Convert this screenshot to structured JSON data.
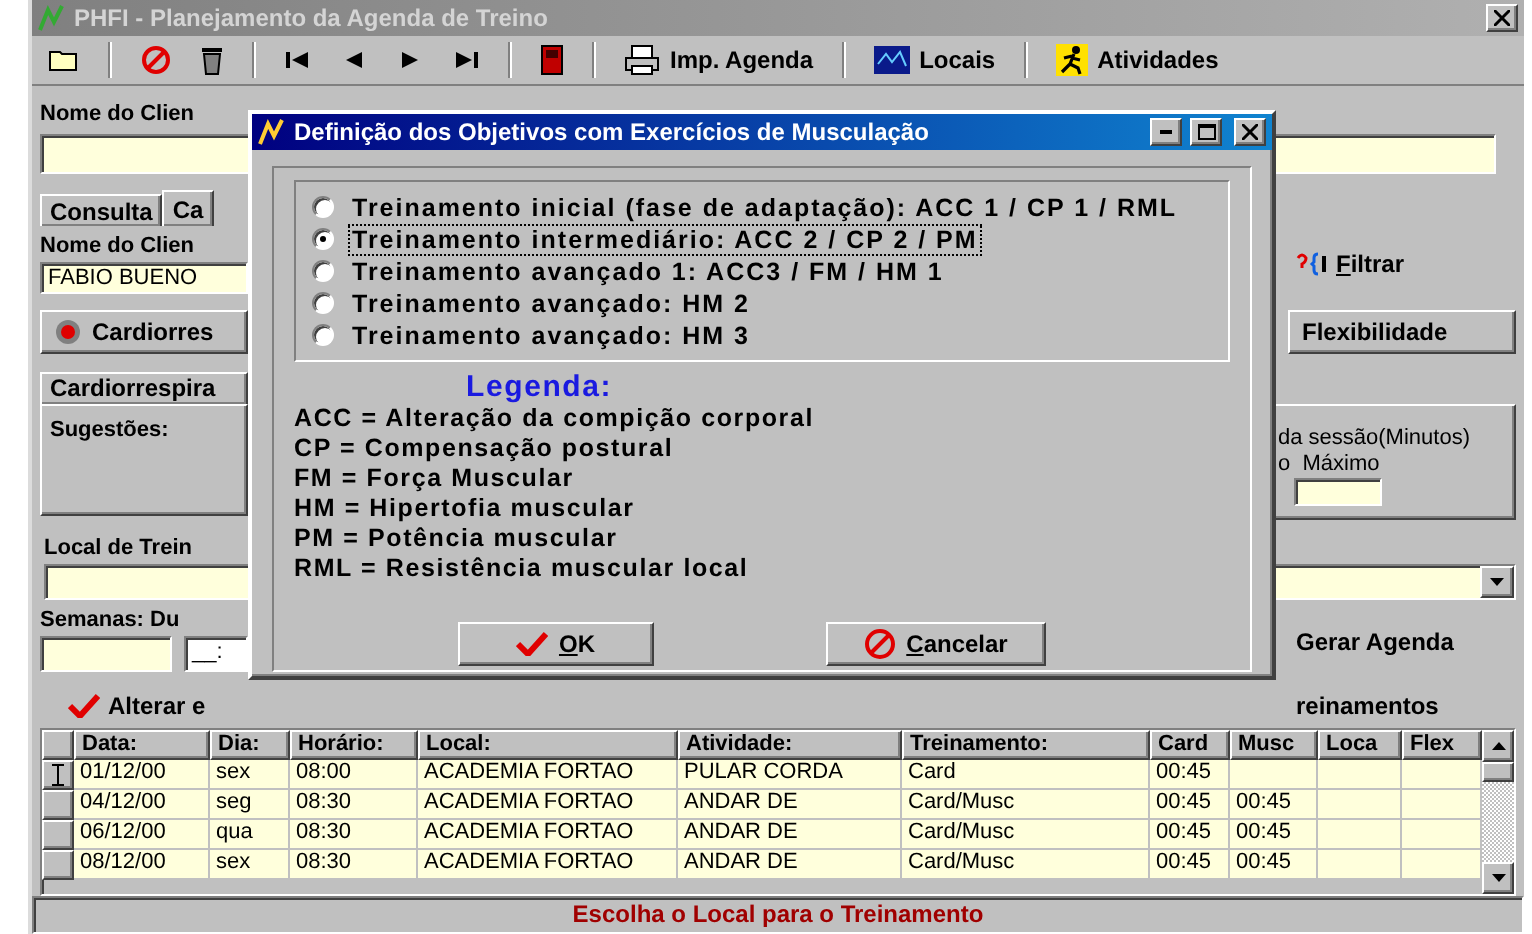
{
  "window": {
    "title": "PHFI - Planejamento da Agenda de Treino",
    "active": false
  },
  "toolbar": [
    {
      "kind": "printer",
      "label": "Imp. Agenda"
    },
    {
      "kind": "map",
      "label": "Locais"
    },
    {
      "kind": "runner",
      "label": "Atividades"
    }
  ],
  "client_name": {
    "label": "Nome do Clien"
  },
  "tabs": [
    {
      "label": "Consulta",
      "selected": false
    },
    {
      "label": "Ca",
      "selected": true
    }
  ],
  "filter": {
    "label": "Nome do Clien",
    "value": "FABIO BUENO",
    "button": "Filtrar"
  },
  "category_buttons": [
    {
      "label": "Cardiorres"
    },
    {
      "label": "Flexibilidade"
    }
  ],
  "subtab": {
    "label": "Cardiorrespira"
  },
  "suggestions": {
    "label": "Sugestões:"
  },
  "session": {
    "title": "da sessão(Minutos)",
    "max_label": "o  Máximo"
  },
  "local": {
    "label": "Local de Trein"
  },
  "weeks": {
    "label": "Semanas:",
    "duration_label": "Du",
    "duration_value": "__:"
  },
  "generate_button": "Gerar Agenda",
  "alter_button": "Alterar e",
  "trainings_button": "reinamentos",
  "table": {
    "columns": [
      "Data:",
      "Dia:",
      "Horário:",
      "Local:",
      "Atividade:",
      "Treinamento:",
      "Card",
      "Musc",
      "Loca",
      "Flex"
    ],
    "rows": [
      {
        "current": true,
        "cells": [
          "01/12/00",
          "sex",
          "08:00",
          "ACADEMIA FORTAO",
          "PULAR CORDA",
          "Card",
          "00:45"
        ]
      },
      {
        "current": false,
        "cells": [
          "04/12/00",
          "seg",
          "08:30",
          "ACADEMIA FORTAO",
          "ANDAR DE",
          "Card/Musc",
          "00:45",
          "00:45"
        ]
      },
      {
        "current": false,
        "cells": [
          "06/12/00",
          "qua",
          "08:30",
          "ACADEMIA FORTAO",
          "ANDAR DE",
          "Card/Musc",
          "00:45",
          "00:45"
        ]
      },
      {
        "current": false,
        "cells": [
          "08/12/00",
          "sex",
          "08:30",
          "ACADEMIA FORTAO",
          "ANDAR DE",
          "Card/Musc",
          "00:45",
          "00:45"
        ]
      }
    ]
  },
  "status_bar": "Escolha o Local para o Treinamento",
  "dialog": {
    "title": "Definição dos Objetivos com Exercícios de Musculação",
    "active": true,
    "options": [
      {
        "label": "Treinamento inicial (fase de adaptação): ACC 1 / CP 1 / RML",
        "selected": false
      },
      {
        "label": "Treinamento intermediário: ACC 2 / CP 2 / PM",
        "selected": true
      },
      {
        "label": "Treinamento avançado 1: ACC3 / FM / HM 1",
        "selected": false
      },
      {
        "label": "Treinamento avançado: HM 2",
        "selected": false
      },
      {
        "label": "Treinamento avançado: HM 3",
        "selected": false
      }
    ],
    "legend_title": "Legenda:",
    "legend": [
      "ACC = Alteração da compição corporal",
      "CP = Compensação postural",
      "FM = Força Muscular",
      "HM = Hipertofia muscular",
      "PM = Potência muscular",
      "RML = Resistência muscular local"
    ],
    "buttons": [
      {
        "kind": "ok",
        "label": "OK"
      },
      {
        "kind": "cancel",
        "label": "Cancelar"
      }
    ]
  }
}
